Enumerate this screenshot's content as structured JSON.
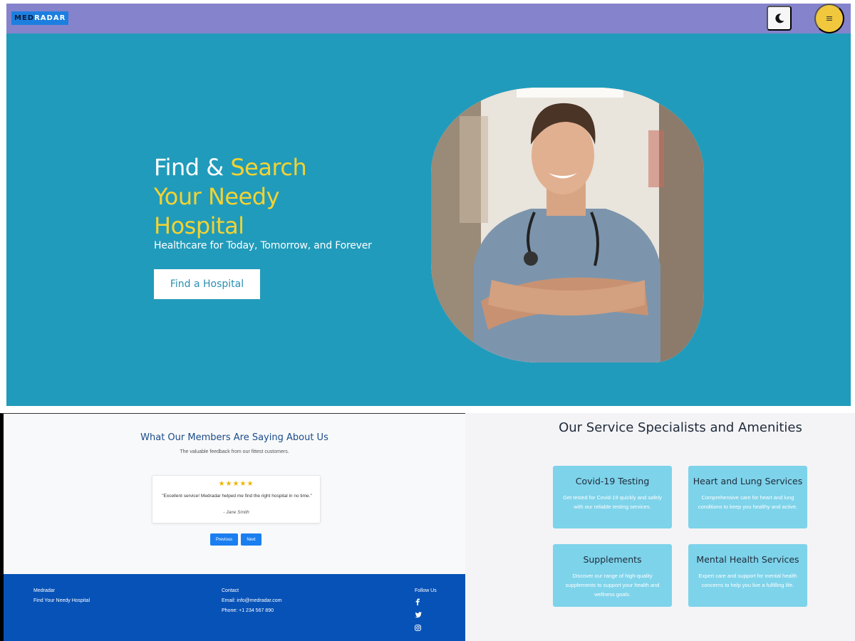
{
  "brand": {
    "logo_left": "MED",
    "logo_right": "RADAR"
  },
  "header": {
    "theme_icon": "moon-icon",
    "menu_icon": "menu-icon",
    "accent": "#f0c73d",
    "nav_bg": "#8583cc"
  },
  "hero": {
    "title_plain": "Find & ",
    "title_highlight_1": "Search",
    "title_highlight_2": "Your Needy",
    "title_highlight_3": "Hospital",
    "subtitle": "Healthcare for Today, Tomorrow, and Forever",
    "cta": "Find a Hospital",
    "bg": "#219bbb",
    "highlight": "#f3d331"
  },
  "testimonials": {
    "heading": "What Our Members Are Saying About Us",
    "subheading": "The valuable feedback from our fittest customers.",
    "rating": "★★★★★",
    "quote": "\"Excellent service! Medradar helped me find the right hospital in no time.\"",
    "author": "- Jane Smith",
    "prev": "Previous",
    "next": "Next"
  },
  "footer": {
    "brand": "Medradar",
    "tagline": "Find Your Needy Hospital",
    "contact_heading": "Contact",
    "email": "Email: info@medradar.com",
    "phone": "Phone: +1 234 567 890",
    "follow_heading": "Follow Us",
    "bg": "#0752b7"
  },
  "services": {
    "heading": "Our Service Specialists and Amenities",
    "items": [
      {
        "title": "Covid-19 Testing",
        "desc": "Get tested for Covid-19 quickly and safely with our reliable testing services."
      },
      {
        "title": "Heart and Lung Services",
        "desc": "Comprehensive care for heart and lung conditions to keep you healthy and active."
      },
      {
        "title": "Supplements",
        "desc": "Discover our range of high-quality supplements to support your health and wellness goals."
      },
      {
        "title": "Mental Health Services",
        "desc": "Expert care and support for mental health concerns to help you live a fulfilling life."
      }
    ],
    "card_bg": "#7dd3ea"
  }
}
